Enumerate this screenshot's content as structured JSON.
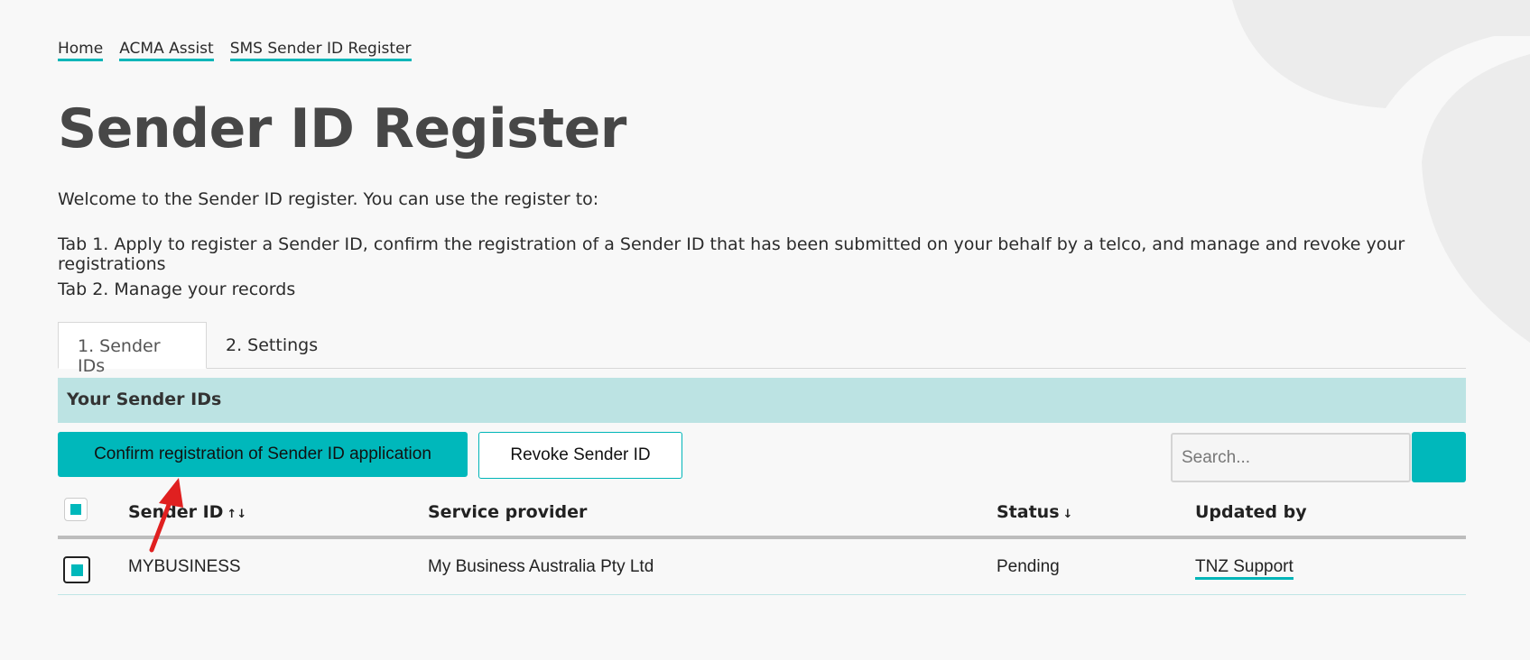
{
  "breadcrumb": [
    "Home",
    "ACMA Assist",
    "SMS Sender ID Register"
  ],
  "page_title": "Sender ID Register",
  "intro": {
    "line1": "Welcome to the Sender ID register. You can use the register to:",
    "line2": "Tab 1. Apply to register a Sender ID, confirm the registration of a Sender ID that has been submitted on your behalf by a telco, and manage and revoke your registrations",
    "line3": "Tab 2. Manage your records"
  },
  "tabs": [
    {
      "label": "1. Sender IDs",
      "active": true
    },
    {
      "label": "2. Settings",
      "active": false
    }
  ],
  "section_title": "Your Sender IDs",
  "actions": {
    "confirm_label": "Confirm registration of Sender ID application",
    "revoke_label": "Revoke Sender ID",
    "search_placeholder": "Search..."
  },
  "table": {
    "columns": [
      {
        "label": "Sender ID",
        "sort": "↑↓"
      },
      {
        "label": "Service provider",
        "sort": ""
      },
      {
        "label": "Status",
        "sort": "↓"
      },
      {
        "label": "Updated by",
        "sort": ""
      }
    ],
    "rows": [
      {
        "sender_id": "MYBUSINESS",
        "service_provider": "My Business Australia Pty Ltd",
        "status": "Pending",
        "updated_by": "TNZ Support",
        "selected": true
      }
    ]
  },
  "colors": {
    "accent": "#00b8bb",
    "section_bg": "#bce3e3",
    "annotation": "#e02020"
  }
}
